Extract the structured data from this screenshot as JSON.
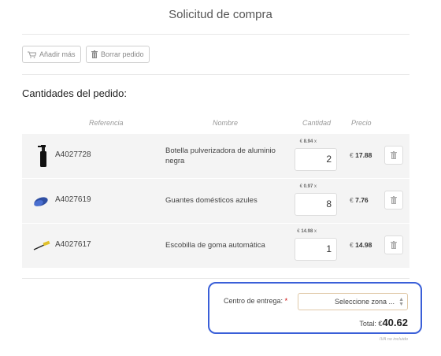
{
  "header": {
    "title": "Solicitud de compra"
  },
  "toolbar": {
    "add_label": "Añadir más",
    "clear_label": "Borrar pedido"
  },
  "section_title": "Cantidades del pedido:",
  "columns": {
    "ref": "Referencia",
    "name": "Nombre",
    "qty": "Cantidad",
    "price": "Precio"
  },
  "items": [
    {
      "ref": "A4027728",
      "name": "Botella pulverizadora de aluminio negra",
      "unit_price": "8.94",
      "qty": "2",
      "total": "17.88",
      "icon": "spray-bottle-icon"
    },
    {
      "ref": "A4027619",
      "name": "Guantes domésticos azules",
      "unit_price": "0.97",
      "qty": "8",
      "total": "7.76",
      "icon": "gloves-icon"
    },
    {
      "ref": "A4027617",
      "name": "Escobilla de goma automática",
      "unit_price": "14.98",
      "qty": "1",
      "total": "14.98",
      "icon": "squeegee-icon"
    }
  ],
  "currency": "€",
  "times": "x",
  "delivery": {
    "label": "Centro de entrega:",
    "required_mark": "*",
    "placeholder": "Seleccione zona ..."
  },
  "total": {
    "label": "Total: €",
    "value": "40.62"
  },
  "iva_note": "IVA no incluido",
  "colors": {
    "highlight": "#3a5fd8",
    "row_bg": "#f4f4f4"
  }
}
